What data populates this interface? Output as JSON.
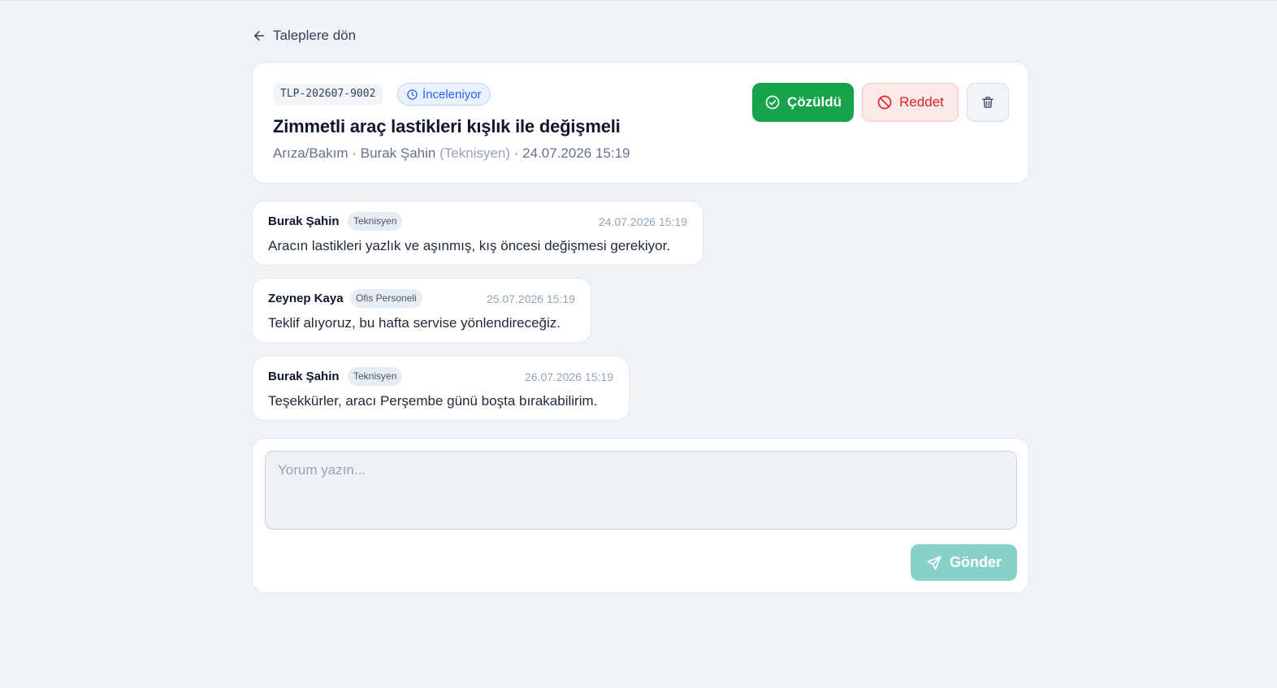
{
  "nav": {
    "back_label": "Taleplere dön"
  },
  "ticket": {
    "id": "TLP-202607-9002",
    "status": "İnceleniyor",
    "title": "Zimmetli araç lastikleri kışlık ile değişmeli",
    "category": "Arıza/Bakım",
    "separator": "·",
    "requester": "Burak Şahin",
    "requester_role": "(Teknisyen)",
    "created_at": "24.07.2026 15:19"
  },
  "actions": {
    "resolve_label": "Çözüldü",
    "reject_label": "Reddet"
  },
  "comments": [
    {
      "author": "Burak Şahin",
      "role": "Teknisyen",
      "time": "24.07.2026 15:19",
      "text": "Aracın lastikleri yazlık ve aşınmış, kış öncesi değişmesi gerekiyor."
    },
    {
      "author": "Zeynep Kaya",
      "role": "Ofis Personeli",
      "time": "25.07.2026 15:19",
      "text": "Teklif alıyoruz, bu hafta servise yönlendireceğiz."
    },
    {
      "author": "Burak Şahin",
      "role": "Teknisyen",
      "time": "26.07.2026 15:19",
      "text": "Teşekkürler, aracı Perşembe günü boşta bırakabilirim."
    }
  ],
  "composer": {
    "value": "",
    "placeholder": "Yorum yazın...",
    "send_label": "Gönder"
  },
  "colors": {
    "page_bg": "#eff3f8",
    "resolve": "#16a34a",
    "reject": "#dc2626",
    "status_blue": "#2563eb",
    "send_disabled": "#86d1c8"
  }
}
